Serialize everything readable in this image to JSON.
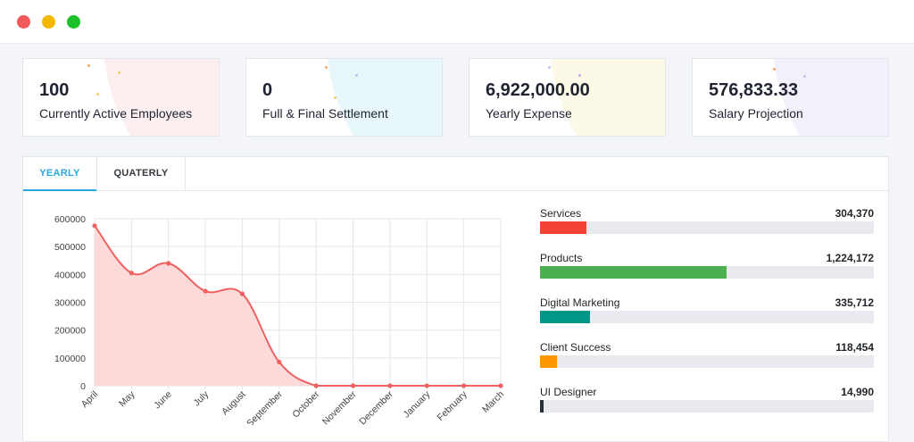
{
  "window": {
    "controls": [
      "close",
      "minimize",
      "maximize"
    ]
  },
  "stats": [
    {
      "value": "100",
      "label": "Currently Active Employees",
      "tint": "#fdeef0"
    },
    {
      "value": "0",
      "label": "Full & Final Settlement",
      "tint": "#e8f8fa"
    },
    {
      "value": "6,922,000.00",
      "label": "Yearly Expense",
      "tint": "#fcf9e6"
    },
    {
      "value": "576,833.33",
      "label": "Salary Projection",
      "tint": "#f1f0fb"
    }
  ],
  "tabs": [
    "YEARLY",
    "QUATERLY"
  ],
  "chart_data": {
    "type": "area",
    "categories": [
      "April",
      "May",
      "June",
      "July",
      "August",
      "September",
      "October",
      "November",
      "December",
      "January",
      "February",
      "March"
    ],
    "values": [
      575000,
      405000,
      440000,
      340000,
      330000,
      85000,
      0,
      0,
      0,
      0,
      0,
      0
    ],
    "ylim": [
      0,
      600000
    ],
    "yticks": [
      "0",
      "100000",
      "200000",
      "300000",
      "400000",
      "500000",
      "600000"
    ],
    "grid": true,
    "line_color": "#f06161",
    "fill_color": "#fdd6d6"
  },
  "categories_breakdown": [
    {
      "name": "Services",
      "value": "304,370",
      "fraction": 0.14,
      "color": "#f44336"
    },
    {
      "name": "Products",
      "value": "1,224,172",
      "fraction": 0.56,
      "color": "#4caf50"
    },
    {
      "name": "Digital Marketing",
      "value": "335,712",
      "fraction": 0.15,
      "color": "#009688"
    },
    {
      "name": "Client Success",
      "value": "118,454",
      "fraction": 0.05,
      "color": "#ff9800"
    },
    {
      "name": "UI Designer",
      "value": "14,990",
      "fraction": 0.01,
      "color": "#263238"
    }
  ]
}
